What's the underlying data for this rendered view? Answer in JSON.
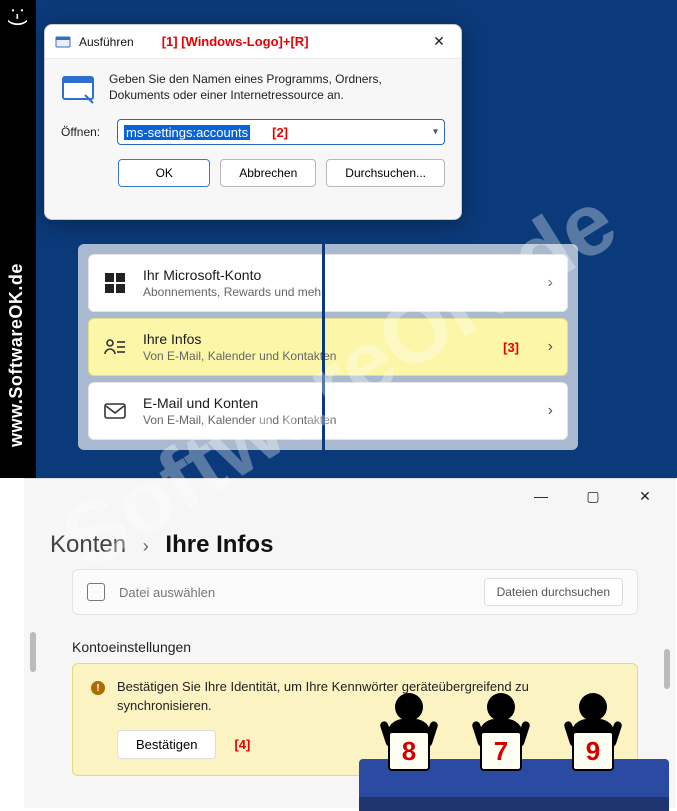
{
  "left_banner": {
    "smile": ":-)",
    "text": "www.SoftwareOK.de"
  },
  "watermark": "SoftwareOK.de",
  "run_dialog": {
    "title": "Ausführen",
    "annotation1": "[1]  [Windows-Logo]+[R]",
    "description": "Geben Sie den Namen eines Programms, Ordners, Dokuments oder einer Internetressource an.",
    "open_label": "Öffnen:",
    "command_value": "ms-settings:accounts",
    "annotation2": "[2]",
    "buttons": {
      "ok": "OK",
      "cancel": "Abbrechen",
      "browse": "Durchsuchen..."
    }
  },
  "settings_list": {
    "rows": [
      {
        "title": "Ihr Microsoft-Konto",
        "sub": "Abonnements, Rewards und mehr"
      },
      {
        "title": "Ihre Infos",
        "sub": "Von E-Mail, Kalender und Kontakten",
        "annotation": "[3]"
      },
      {
        "title": "E-Mail und Konten",
        "sub": "Von E-Mail, Kalender und Kontakten"
      }
    ]
  },
  "bottom_window": {
    "breadcrumb": {
      "c1": "Konten",
      "sep": "›",
      "c2": "Ihre Infos"
    },
    "file_row": {
      "select_label": "Datei auswählen",
      "browse_label": "Dateien durchsuchen"
    },
    "section_header": "Kontoeinstellungen",
    "warn": {
      "text": "Bestätigen Sie Ihre Identität, um Ihre Kennwörter geräteübergreifend zu synchronisieren.",
      "confirm": "Bestätigen",
      "annotation4": "[4]"
    }
  },
  "judges": {
    "scores": [
      "8",
      "7",
      "9"
    ]
  }
}
